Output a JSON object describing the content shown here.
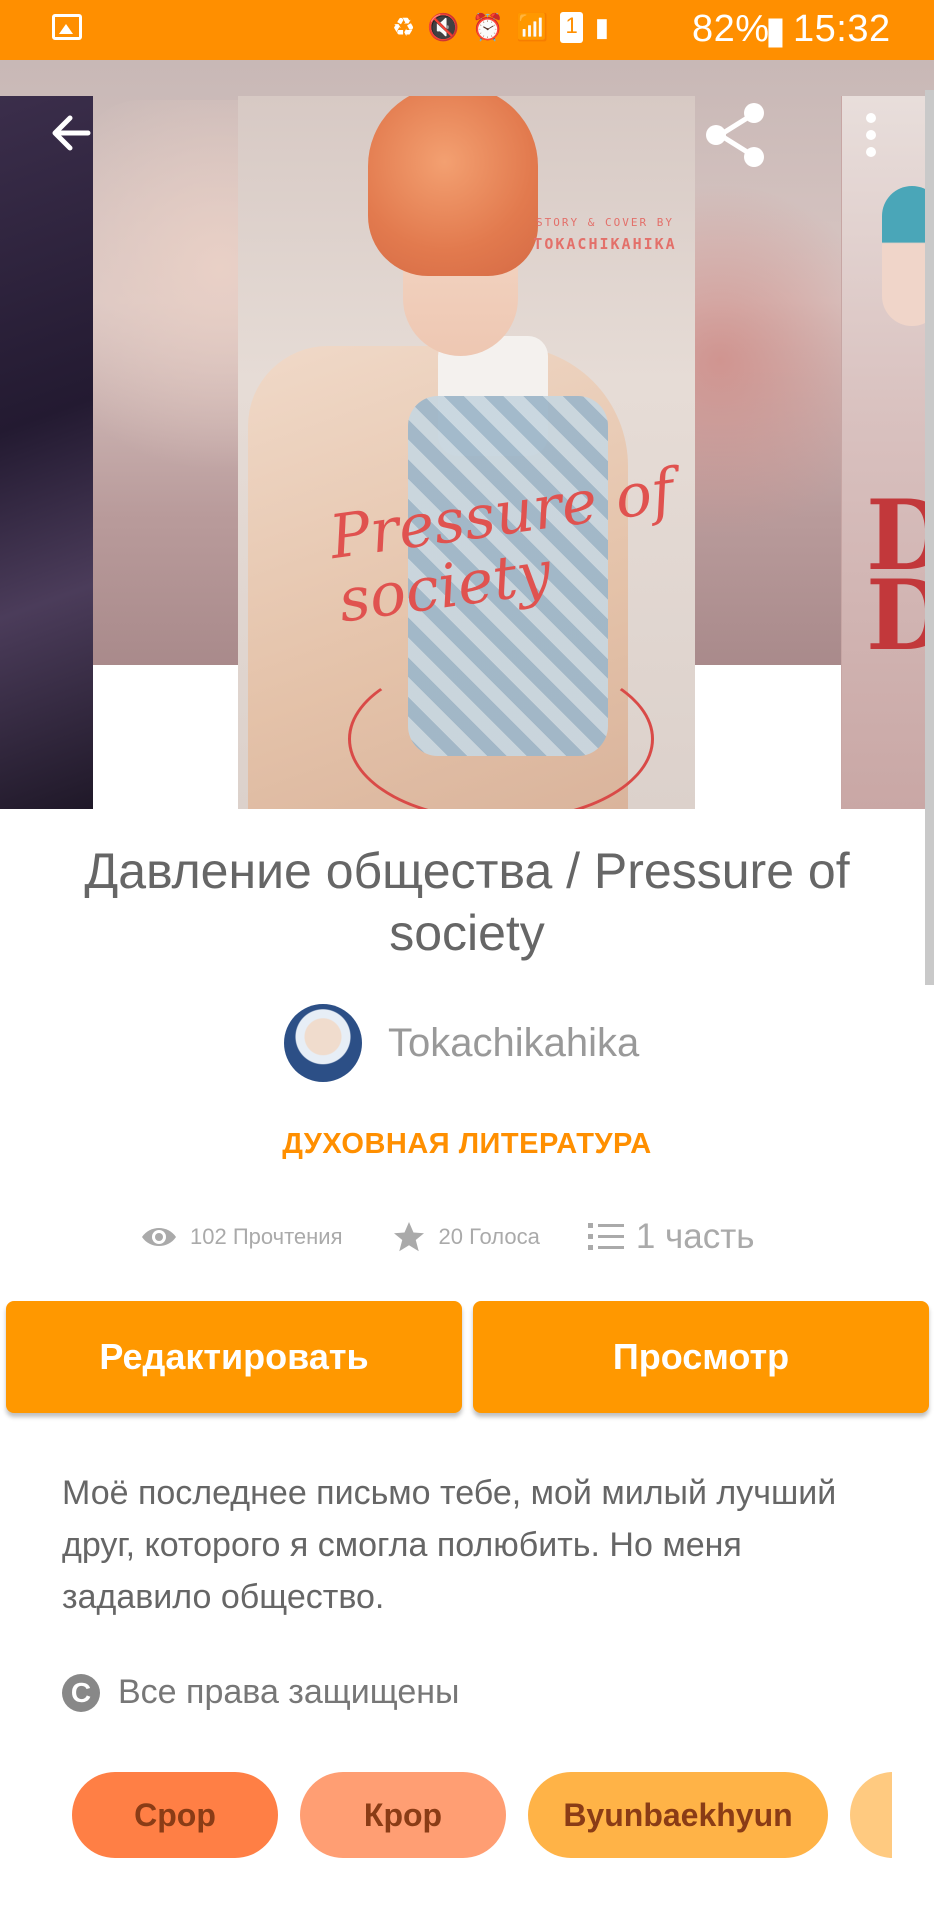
{
  "status_bar": {
    "battery_text": "82%",
    "time": "15:32",
    "sim_number": "1"
  },
  "header": {
    "cover_credit_line1": "STORY & COVER BY",
    "cover_credit_line2": "TOKACHIKAHIKA",
    "cover_script_title": "Pressure of society"
  },
  "story": {
    "title": "Давление общества / Pressure of society",
    "author": "Tokachikahika",
    "genre": "ДУХОВНАЯ ЛИТЕРАТУРА",
    "reads": "102 Прочтения",
    "votes": "20 Голоса",
    "parts": "1 часть",
    "description": "Моё последнее письмо тебе, мой милый лучший друг, которого я смогла полюбить. Но меня задавило общество.",
    "copyright": "Все права защищены"
  },
  "actions": {
    "edit_label": "Редактировать",
    "view_label": "Просмотр"
  },
  "tags": [
    "Срор",
    "Кроp",
    "Byunbaekhyun"
  ],
  "colors": {
    "accent": "#ff8f00",
    "button": "#ff9800",
    "tag1": "#ff7f45",
    "tag2": "#ff9e73",
    "tag3": "#ffb347"
  }
}
